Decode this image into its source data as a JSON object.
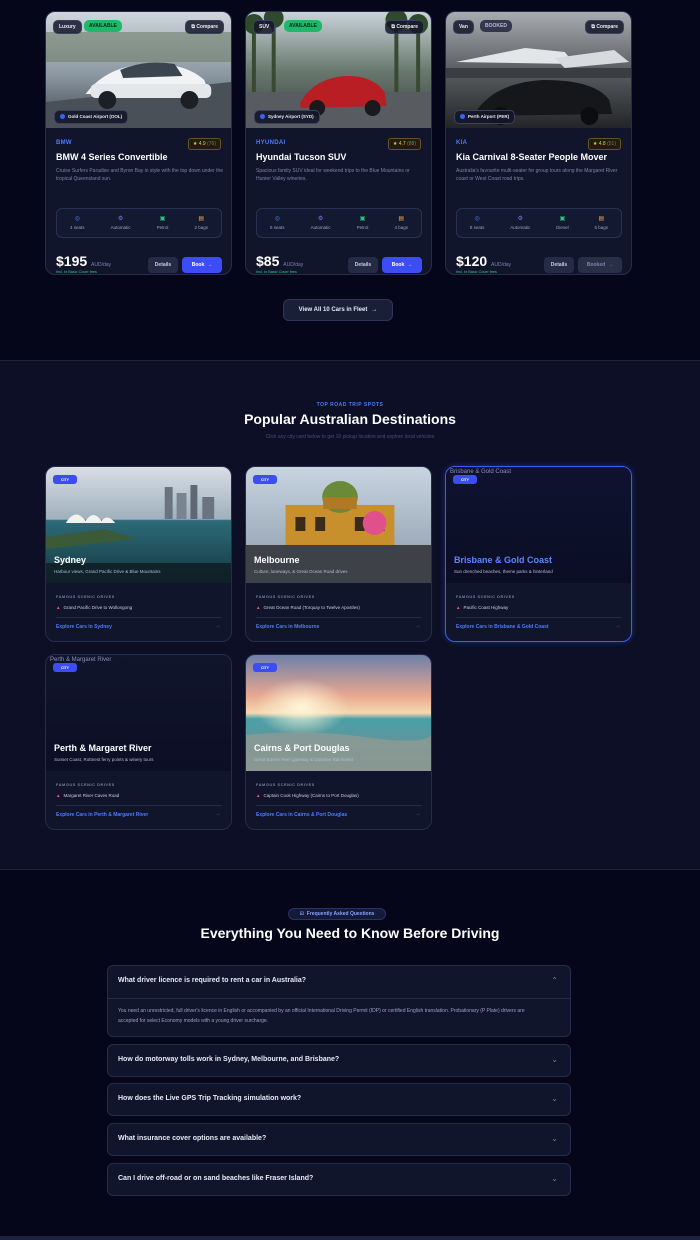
{
  "cars": [
    {
      "category": "Luxury",
      "availability": "AVAILABLE",
      "compare_label": "Compare",
      "airport": "Gold Coast Airport (OOL)",
      "brand": "BMW",
      "rating": "4.9",
      "rating_count": "(76)",
      "title": "BMW 4 Series Convertible",
      "description": "Cruise Surfers Paradise and Byron Bay in style with the top down under the tropical Queensland sun.",
      "specs": [
        "4 seats",
        "Automatic",
        "Petrol",
        "2 bags"
      ],
      "price": "$195",
      "per": "AUD/day",
      "price_note": "Incl. In Basic Cover fees",
      "details_label": "Details",
      "book_label": "Book"
    },
    {
      "category": "SUV",
      "availability": "AVAILABLE",
      "compare_label": "Compare",
      "airport": "Sydney Airport (SYD)",
      "brand": "HYUNDAI",
      "rating": "4.7",
      "rating_count": "(88)",
      "title": "Hyundai Tucson SUV",
      "description": "Spacious family SUV ideal for weekend trips to the Blue Mountains or Hunter Valley wineries.",
      "specs": [
        "5 seats",
        "Automatic",
        "Petrol",
        "4 bags"
      ],
      "price": "$85",
      "per": "AUD/day",
      "price_note": "Incl. In Basic Cover fees",
      "details_label": "Details",
      "book_label": "Book"
    },
    {
      "category": "Van",
      "availability": "BOOKED",
      "compare_label": "Compare",
      "airport": "Perth Airport (PER)",
      "brand": "KIA",
      "rating": "4.8",
      "rating_count": "(51)",
      "title": "Kia Carnival 8-Seater People Mover",
      "description": "Australia's favourite multi-seater for group tours along the Margaret River coast or West Coast road trips.",
      "specs": [
        "8 seats",
        "Automatic",
        "Diesel",
        "5 bags"
      ],
      "price": "$120",
      "per": "AUD/day",
      "price_note": "Incl. In Basic Cover fees",
      "details_label": "Details",
      "book_label": "Booked"
    }
  ],
  "view_all_label": "View All 10 Cars in Fleet",
  "destinations_section": {
    "eyebrow": "TOP ROAD TRIP SPOTS",
    "title": "Popular Australian Destinations",
    "subtitle": "Click any city card below to get 10 pickup location and explore local vehicles",
    "drives_label": "FAMOUS SCENIC DRIVES",
    "badge": "CITY",
    "cards": [
      {
        "name": "Sydney",
        "alt": "",
        "desc": "Harbour views, Grand Pacific Drive & Blue Mountains",
        "drive": "Grand Pacific Drive to Wollongong",
        "explore": "Explore Cars in Sydney"
      },
      {
        "name": "Melbourne",
        "alt": "",
        "desc": "Culture, laneways, & Great Ocean Road drives",
        "drive": "Great Ocean Road (Torquay to Twelve Apostles)",
        "explore": "Explore Cars in Melbourne"
      },
      {
        "name": "Brisbane & Gold Coast",
        "alt": "Brisbane & Gold Coast",
        "desc": "Sun drenched beaches, theme parks & hinterland",
        "drive": "Pacific Coast Highway",
        "explore": "Explore Cars in Brisbane & Gold Coast"
      },
      {
        "name": "Perth & Margaret River",
        "alt": "Perth & Margaret River",
        "desc": "Sunset Coast, Rottnest ferry points & winery tours",
        "drive": "Margaret River Caves Road",
        "explore": "Explore Cars in Perth & Margaret River"
      },
      {
        "name": "Cairns & Port Douglas",
        "alt": "",
        "desc": "Great Barrier Reef gateway & Daintree Rainforest",
        "drive": "Captain Cook Highway (Cairns to Port Douglas)",
        "explore": "Explore Cars in Cairns & Port Douglas"
      }
    ]
  },
  "faq": {
    "chip": "Frequently Asked Questions",
    "title": "Everything You Need to Know Before Driving",
    "items": [
      {
        "q": "What driver licence is required to rent a car in Australia?",
        "a": "You need an unrestricted, full driver's licence in English or accompanied by an official International Driving Permit (IDP) or certified English translation. Probationary (P Plate) drivers are accepted for select Economy models with a young driver surcharge."
      },
      {
        "q": "How do motorway tolls work in Sydney, Melbourne, and Brisbane?"
      },
      {
        "q": "How does the Live GPS Trip Tracking simulation work?"
      },
      {
        "q": "What insurance cover options are available?"
      },
      {
        "q": "Can I drive off-road or on sand beaches like Fraser Island?"
      }
    ]
  },
  "colors": {
    "accent": "#3d4df5",
    "available": "#1fb86b",
    "background": "#05061a"
  }
}
